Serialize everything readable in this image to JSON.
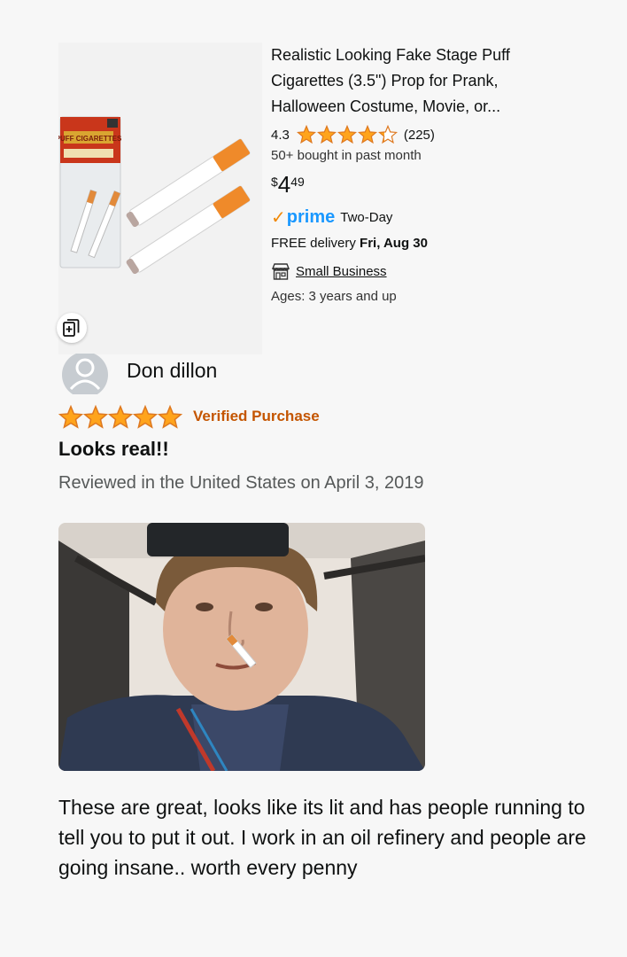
{
  "product": {
    "title": "Realistic Looking Fake Stage Puff Cigarettes (3.5\") Prop for Prank, Halloween Costume, Movie, or...",
    "rating": "4.3",
    "rating_value": 4.3,
    "rating_count": "(225)",
    "bought": "50+ bought in past month",
    "price_symbol": "$",
    "price_whole": "4",
    "price_fraction": "49",
    "prime_check": "✓",
    "prime_label": "prime",
    "prime_speed": "Two-Day",
    "delivery_prefix": "FREE delivery",
    "delivery_date": "Fri, Aug 30",
    "small_business": "Small Business",
    "ages": "Ages: 3 years and up",
    "package_label": "PUFF CIGARETTES"
  },
  "review": {
    "reviewer": "Don dillon",
    "stars": 5,
    "verified": "Verified Purchase",
    "title": "Looks real!!",
    "date": "Reviewed in the United States on April 3, 2019",
    "body": "These are great, looks like its lit and has people running to tell you to put it out. I work in an oil refinery and people are going insane.. worth every penny"
  },
  "colors": {
    "star": "#ffa41c",
    "verified": "#c45500",
    "prime_blue": "#1a98ff",
    "prime_check": "#f08804"
  },
  "icons": [
    "save-to-list-icon",
    "star-icon",
    "small-business-icon",
    "avatar-icon"
  ]
}
